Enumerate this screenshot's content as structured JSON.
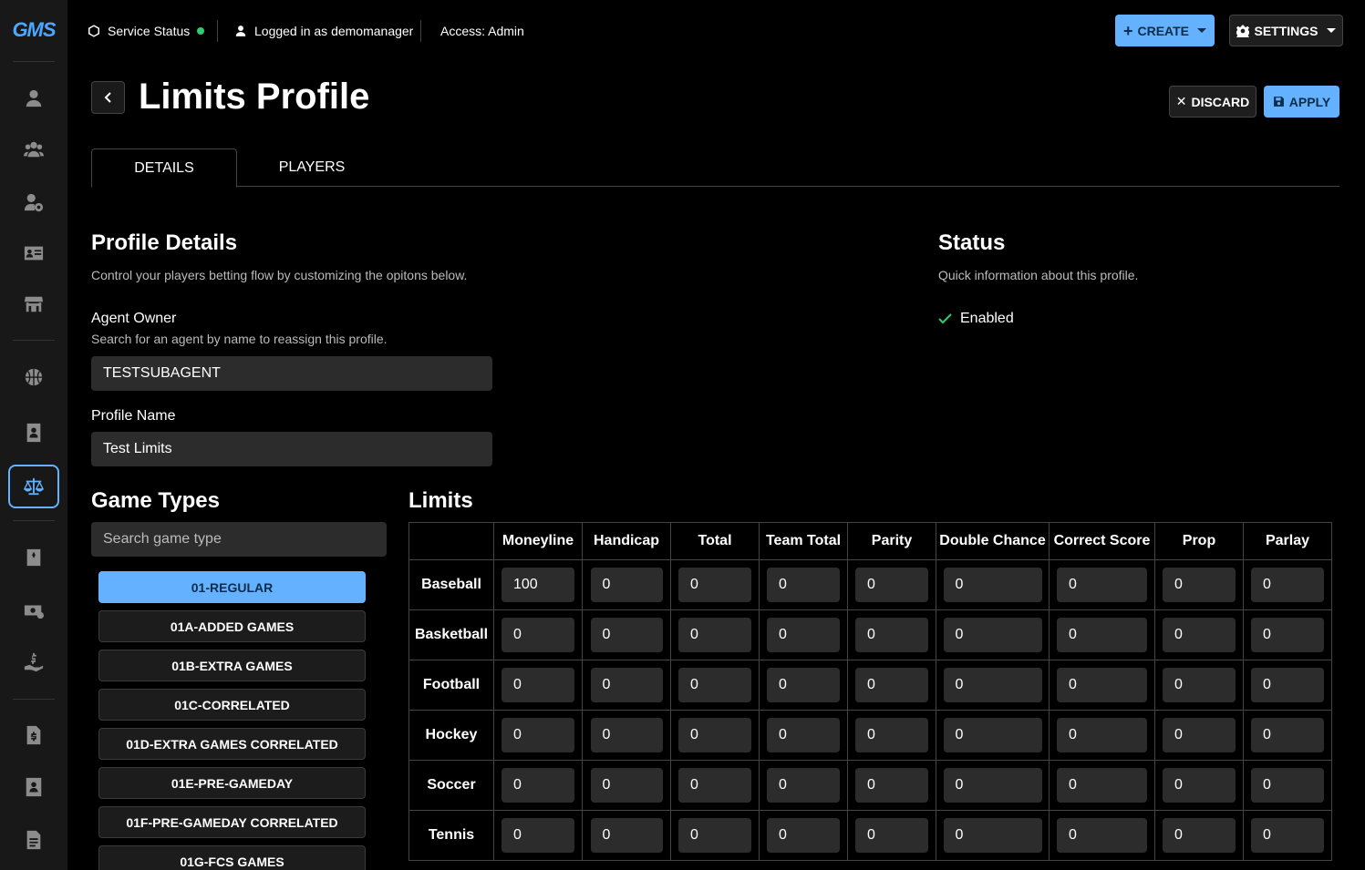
{
  "logo": "GMS",
  "topbar": {
    "service_status": "Service Status",
    "logged_in": "Logged in as demomanager",
    "access": "Access: Admin",
    "create_label": "CREATE",
    "settings_label": "SETTINGS"
  },
  "page": {
    "title": "Limits Profile",
    "discard_label": "DISCARD",
    "apply_label": "APPLY"
  },
  "tabs": [
    {
      "label": "DETAILS",
      "active": true
    },
    {
      "label": "PLAYERS",
      "active": false
    }
  ],
  "profile_details": {
    "heading": "Profile Details",
    "subtitle": "Control your players betting flow by customizing the opitons below.",
    "agent_owner_label": "Agent Owner",
    "agent_owner_help": "Search for an agent by name to reassign this profile.",
    "agent_owner_value": "TESTSUBAGENT",
    "profile_name_label": "Profile Name",
    "profile_name_value": "Test Limits"
  },
  "status": {
    "heading": "Status",
    "subtitle": "Quick information about this profile.",
    "state": "Enabled"
  },
  "game_types": {
    "heading": "Game Types",
    "search_placeholder": "Search game type",
    "items": [
      "01-REGULAR",
      "01A-ADDED GAMES",
      "01B-EXTRA GAMES",
      "01C-CORRELATED",
      "01D-EXTRA GAMES CORRELATED",
      "01E-PRE-GAMEDAY",
      "01F-PRE-GAMEDAY CORRELATED",
      "01G-FCS GAMES"
    ],
    "selected": "01-REGULAR"
  },
  "limits": {
    "heading": "Limits",
    "columns": [
      "Moneyline",
      "Handicap",
      "Total",
      "Team Total",
      "Parity",
      "Double Chance",
      "Correct Score",
      "Prop",
      "Parlay"
    ],
    "rows": [
      {
        "sport": "Baseball",
        "values": [
          "100",
          "0",
          "0",
          "0",
          "0",
          "0",
          "0",
          "0",
          "0"
        ]
      },
      {
        "sport": "Basketball",
        "values": [
          "0",
          "0",
          "0",
          "0",
          "0",
          "0",
          "0",
          "0",
          "0"
        ]
      },
      {
        "sport": "Football",
        "values": [
          "0",
          "0",
          "0",
          "0",
          "0",
          "0",
          "0",
          "0",
          "0"
        ]
      },
      {
        "sport": "Hockey",
        "values": [
          "0",
          "0",
          "0",
          "0",
          "0",
          "0",
          "0",
          "0",
          "0"
        ]
      },
      {
        "sport": "Soccer",
        "values": [
          "0",
          "0",
          "0",
          "0",
          "0",
          "0",
          "0",
          "0",
          "0"
        ]
      },
      {
        "sport": "Tennis",
        "values": [
          "0",
          "0",
          "0",
          "0",
          "0",
          "0",
          "0",
          "0",
          "0"
        ]
      }
    ]
  },
  "colors": {
    "accent": "#64b2ff",
    "status_ok": "#2ecc71",
    "background": "#000000"
  }
}
